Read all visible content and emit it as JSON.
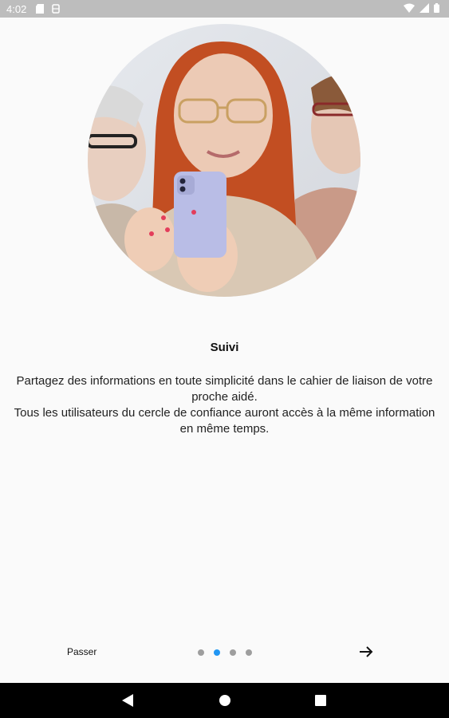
{
  "status_bar": {
    "time": "4:02",
    "icons": [
      "sd-card-icon",
      "storage-icon",
      "wifi-icon",
      "signal-icon",
      "battery-icon"
    ]
  },
  "onboarding": {
    "title": "Suivi",
    "description_line1": "Partagez des informations en toute simplicité dans le cahier de liaison de votre proche aidé.",
    "description_line2": "Tous les utilisateurs du cercle de confiance auront accès à la même information en même temps."
  },
  "footer": {
    "skip_label": "Passer",
    "page_count": 4,
    "active_page": 2,
    "next_icon": "arrow-right-icon",
    "active_color": "#2196f3",
    "inactive_color": "#9e9e9e"
  },
  "nav_bar": {
    "icons": [
      "back-icon",
      "home-icon",
      "recents-icon"
    ]
  }
}
